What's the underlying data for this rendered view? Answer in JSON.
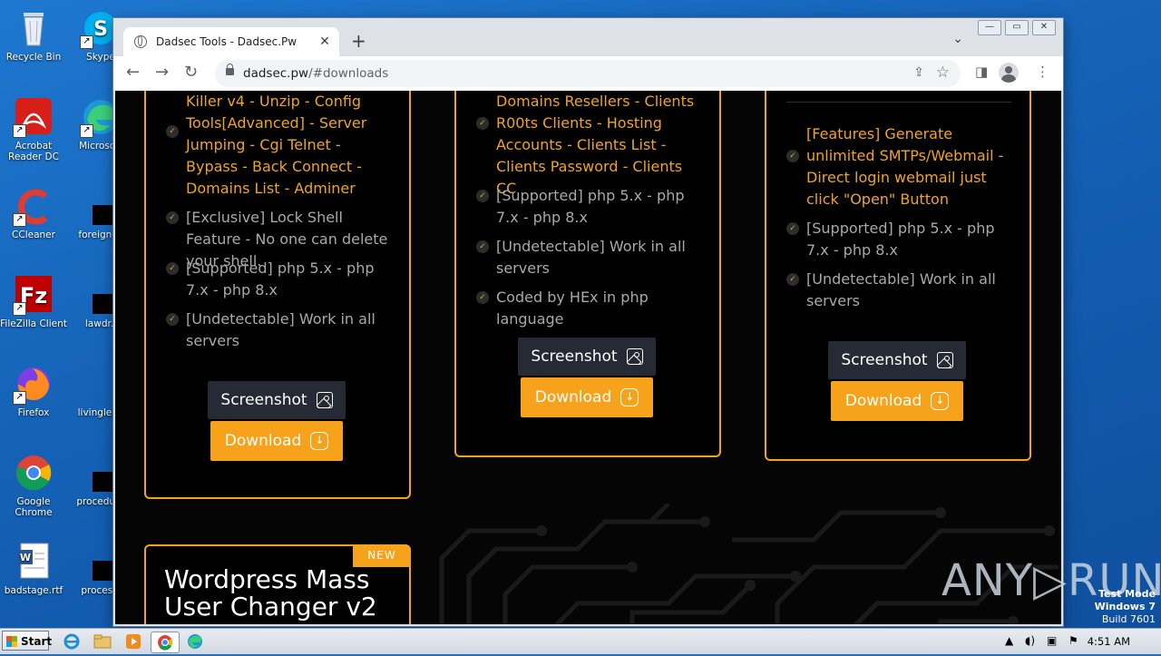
{
  "desktop": {
    "icons": [
      {
        "label": "Recycle Bin"
      },
      {
        "label": "Skype"
      },
      {
        "label": "Acrobat Reader DC"
      },
      {
        "label": "Microsoft"
      },
      {
        "label": "CCleaner"
      },
      {
        "label": "foreignoil"
      },
      {
        "label": "FileZilla Client"
      },
      {
        "label": "lawdr.j"
      },
      {
        "label": "Firefox"
      },
      {
        "label": "livinglead"
      },
      {
        "label": "Google Chrome"
      },
      {
        "label": "procedure"
      },
      {
        "label": "badstage.rtf"
      },
      {
        "label": "processi"
      }
    ]
  },
  "browser": {
    "tab_title": "Dadsec Tools - Dadsec.Pw",
    "tab_close": "✕",
    "new_tab": "+",
    "url_host": "dadsec.pw",
    "url_path": "/#downloads",
    "window_controls": [
      "—",
      "▭",
      "✕"
    ]
  },
  "cards": [
    {
      "features": [
        {
          "text": "Killer v4 - Unzip - Config Tools[Advanced] - Server Jumping - Cgi Telnet - Bypass - Back Connect - Domains List - Adminer",
          "style": "orange"
        },
        {
          "text": "[Exclusive] Lock Shell Feature - No one can delete your shell.",
          "style": "grey"
        },
        {
          "text": "[Supported] php 5.x - php 7.x - php 8.x",
          "style": "grey"
        },
        {
          "text": "[Undetectable] Work in all servers",
          "style": "grey"
        }
      ],
      "screenshot_label": "Screenshot",
      "download_label": "Download"
    },
    {
      "features": [
        {
          "text": "Domains Resellers - Clients R00ts Clients - Hosting Accounts - Clients List - Clients Password - Clients CC",
          "style": "orange"
        },
        {
          "text": "[Supported] php 5.x - php 7.x - php 8.x",
          "style": "grey"
        },
        {
          "text": "[Undetectable] Work in all servers",
          "style": "grey"
        },
        {
          "text": "Coded by HEx in php language",
          "style": "grey"
        }
      ],
      "screenshot_label": "Screenshot",
      "download_label": "Download"
    },
    {
      "features": [
        {
          "text": "[Features] Generate unlimited SMTPs/Webmail - Direct login webmail just click \"Open\" Button",
          "style": "orange"
        },
        {
          "text": "[Supported] php 5.x - php 7.x - php 8.x",
          "style": "grey"
        },
        {
          "text": "[Undetectable] Work in all servers",
          "style": "grey"
        }
      ],
      "screenshot_label": "Screenshot",
      "download_label": "Download"
    }
  ],
  "new_card": {
    "badge": "NEW",
    "title_line1": "Wordpress Mass",
    "title_line2": "User Changer v2"
  },
  "watermark": {
    "brand": "ANY▷RUN",
    "mode_line1": "Test Mode",
    "mode_line2": "Windows 7",
    "mode_line3": "Build 7601"
  },
  "taskbar": {
    "start_label": "Start",
    "clock": "4:51 AM"
  },
  "colors": {
    "accent": "#f6a21a",
    "page_bg": "#050505",
    "feature_orange": "#f0a423",
    "feature_grey": "#a9a9a9"
  }
}
